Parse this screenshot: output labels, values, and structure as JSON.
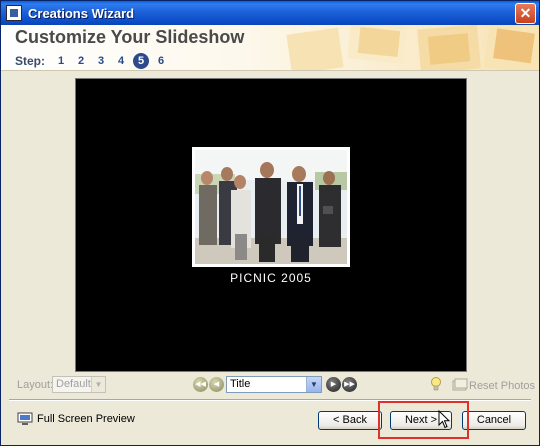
{
  "window": {
    "title": "Creations Wizard",
    "close_glyph": "✕"
  },
  "header": {
    "title": "Customize Your Slideshow",
    "step_label": "Step:",
    "steps": [
      "1",
      "2",
      "3",
      "4",
      "5",
      "6"
    ],
    "active_step": "5"
  },
  "preview": {
    "caption": "PICNIC 2005"
  },
  "controls": {
    "layout_label": "Layout:",
    "layout_value": "Default",
    "title_value": "Title",
    "reset_label": "Reset Photos"
  },
  "footer": {
    "fullscreen_label": "Full Screen Preview",
    "back_label": "< Back",
    "next_label": "Next >",
    "cancel_label": "Cancel"
  },
  "colors": {
    "titlebar": "#0a4cc8",
    "active_step": "#2e4a8c",
    "highlight": "#e0302a"
  }
}
